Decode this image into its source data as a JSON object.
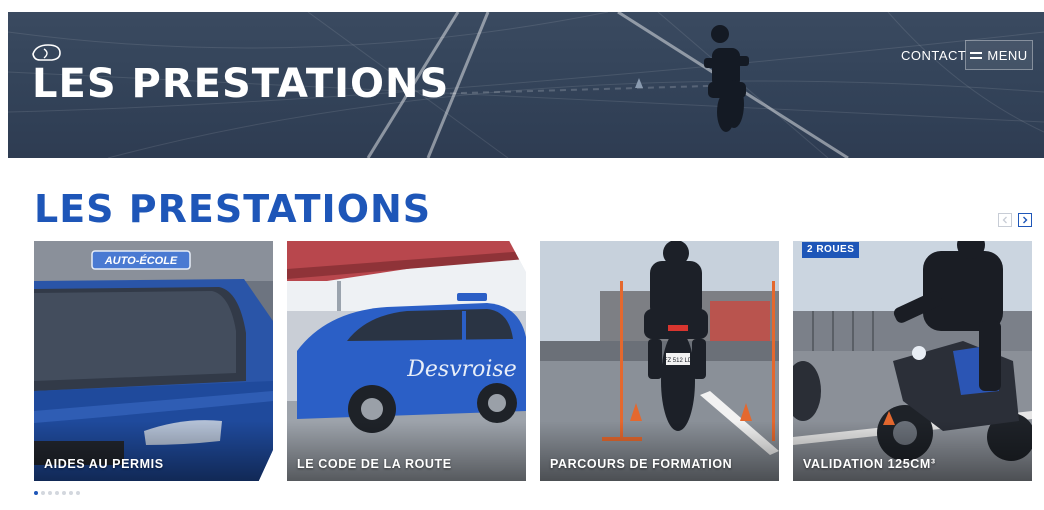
{
  "header": {
    "title": "LES PRESTATIONS",
    "logo_icon": "helmet-logo-icon",
    "nav": {
      "contact_label": "CONTACT",
      "menu_label": "MENU",
      "menu_icon": "hamburger-icon"
    }
  },
  "section": {
    "title": "LES PRESTATIONS",
    "prev_icon": "chevron-left-icon",
    "next_icon": "chevron-right-icon",
    "accent_color": "#1e56b8"
  },
  "cards": [
    {
      "label": "AIDES AU PERMIS",
      "sign_text": "AUTO-ÉCOLE"
    },
    {
      "label": "LE CODE DE LA ROUTE",
      "car_text": "Desvroise"
    },
    {
      "label": "PARCOURS DE FORMATION",
      "plate_text": "FZ 512 LD"
    },
    {
      "label": "VALIDATION 125CM³",
      "badge": "2 ROUES"
    }
  ],
  "carousel": {
    "dot_count": 7,
    "active_index": 0
  }
}
